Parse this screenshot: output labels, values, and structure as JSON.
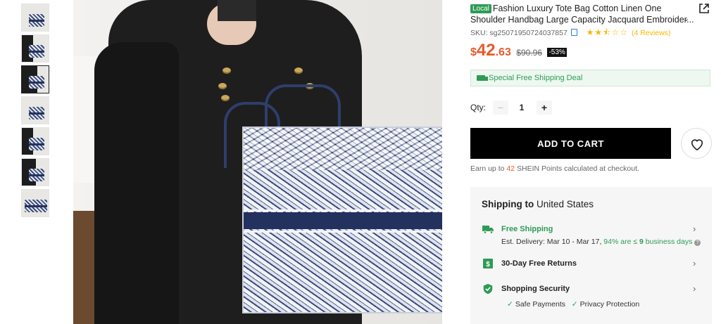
{
  "product": {
    "badge": "Local",
    "title": "Fashion Luxury Tote Bag Cotton Linen One Shoulder Handbag Large Capacity Jacquard Embroider...",
    "sku_label": "SKU: sg25071950724037857",
    "rating": 2.5,
    "stars_text": "★★⯪☆☆",
    "reviews": "(4 Reviews)"
  },
  "price": {
    "currency": "$",
    "main": "42",
    "decimal": ".63",
    "original": "$90.96",
    "discount": "-53%"
  },
  "shipping_deal": "Special Free Shipping Deal",
  "quantity": {
    "label": "Qty:",
    "minus": "−",
    "value": "1",
    "plus": "+"
  },
  "add_to_cart": "ADD TO CART",
  "points": {
    "prefix": "Earn up to ",
    "amount": "42",
    "suffix": " SHEIN Points calculated at checkout."
  },
  "shipping": {
    "title_bold": "Shipping to",
    "country": " United States",
    "free_shipping": {
      "title": "Free Shipping",
      "est_prefix": "Est. Delivery: Mar 10 - Mar 17, ",
      "pct": "94% are ≤ ",
      "days_num": "9",
      "days_suffix": " business days"
    },
    "returns": {
      "title": "30-Day Free Returns"
    },
    "security": {
      "title": "Shopping Security",
      "items": [
        "Safe Payments",
        "Privacy Protection"
      ]
    }
  },
  "colors": {
    "accent_price": "#e85a2c",
    "green": "#2e9b55",
    "star": "#f5b800"
  },
  "icons": [
    "truck-icon",
    "share-icon",
    "heart-icon",
    "copy-icon",
    "returns-icon",
    "shield-icon",
    "chevron-right-icon"
  ]
}
